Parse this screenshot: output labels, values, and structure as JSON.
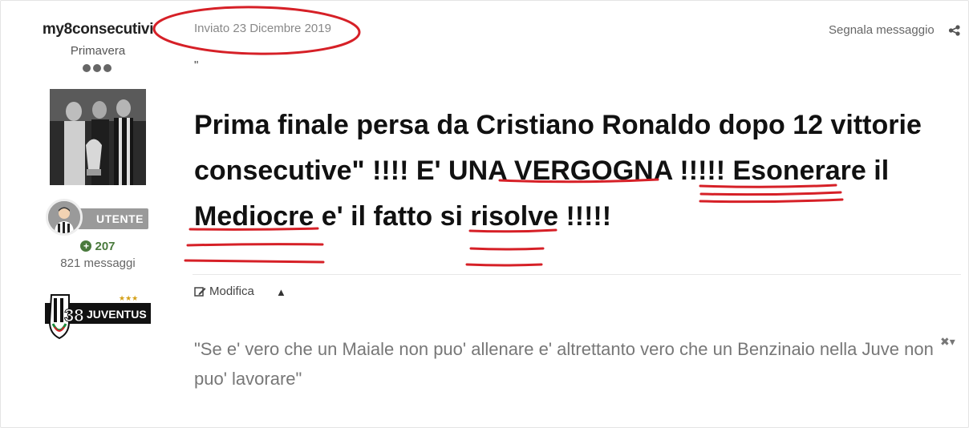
{
  "author": {
    "name": "my8consecutivi",
    "rank": "Primavera",
    "badge_label": "UTENTE",
    "reputation": "207",
    "post_count": "821 messaggi",
    "club_logo_number": "38",
    "club_logo_text": "JUVENTUS"
  },
  "post": {
    "date": "Inviato 23 Dicembre 2019",
    "report_label": "Segnala messaggio",
    "quote_mark": "\"",
    "content": {
      "p1": "Prima finale persa da Cristiano Ronaldo dopo 12 vittorie consecutive\" !!!! E' UNA ",
      "w1": "VERGOGNA",
      "p2": " !!!!! ",
      "w2": "Esonerare il",
      "w3": "Mediocre",
      "p3": " e' il fatto si ",
      "w4": "risolve",
      "p4": " !!!!!"
    },
    "edit_label": "Modifica",
    "signature": "\"Se e' vero che un Maiale non puo' allenare e' altrettanto vero che un Benzinaio nella Juve non puo' lavorare\""
  },
  "colors": {
    "annotation_red": "#d62027",
    "reputation_green": "#4a7a3d",
    "badge_gray": "#9a9a9a"
  }
}
